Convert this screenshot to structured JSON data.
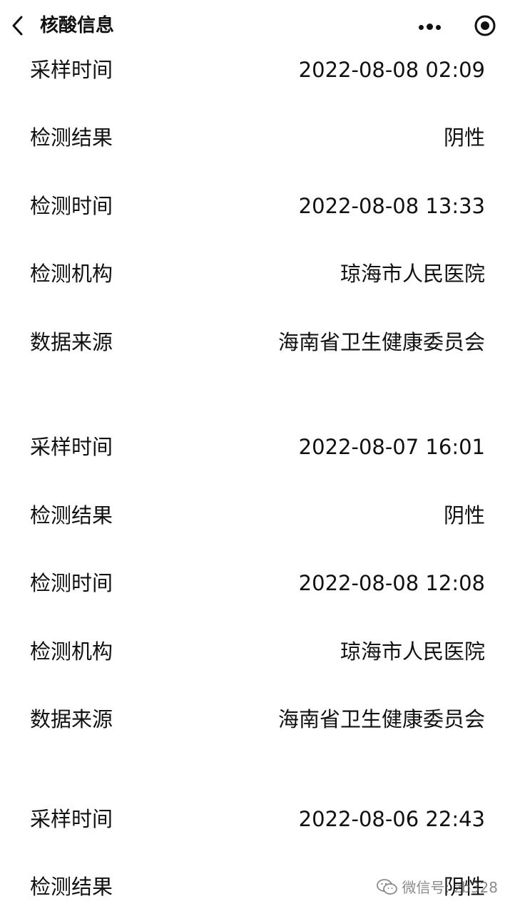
{
  "header": {
    "title": "核酸信息"
  },
  "records": [
    {
      "rows": [
        {
          "label": "采样时间",
          "value": "2022-08-08 02:09"
        },
        {
          "label": "检测结果",
          "value": "阴性"
        },
        {
          "label": "检测时间",
          "value": "2022-08-08 13:33"
        },
        {
          "label": "检测机构",
          "value": "琼海市人民医院"
        },
        {
          "label": "数据来源",
          "value": "海南省卫生健康委员会"
        }
      ]
    },
    {
      "rows": [
        {
          "label": "采样时间",
          "value": "2022-08-07 16:01"
        },
        {
          "label": "检测结果",
          "value": "阴性"
        },
        {
          "label": "检测时间",
          "value": "2022-08-08 12:08"
        },
        {
          "label": "检测机构",
          "value": "琼海市人民医院"
        },
        {
          "label": "数据来源",
          "value": "海南省卫生健康委员会"
        }
      ]
    },
    {
      "rows": [
        {
          "label": "采样时间",
          "value": "2022-08-06 22:43"
        },
        {
          "label": "检测结果",
          "value": "阴性"
        }
      ]
    }
  ],
  "watermark": {
    "text": "微信号: zb328"
  }
}
